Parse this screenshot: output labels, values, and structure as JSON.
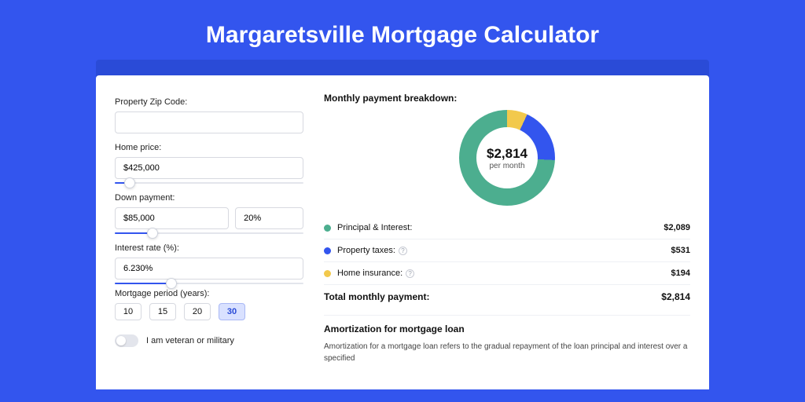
{
  "title": "Margaretsville Mortgage Calculator",
  "form": {
    "zip": {
      "label": "Property Zip Code:",
      "value": ""
    },
    "homePrice": {
      "label": "Home price:",
      "value": "$425,000",
      "sliderPct": 8
    },
    "downPayment": {
      "label": "Down payment:",
      "amount": "$85,000",
      "pct": "20%",
      "sliderPct": 20
    },
    "interest": {
      "label": "Interest rate (%):",
      "value": "6.230%",
      "sliderPct": 30
    },
    "period": {
      "label": "Mortgage period (years):",
      "options": [
        "10",
        "15",
        "20",
        "30"
      ],
      "selected": "30"
    },
    "veteran": {
      "label": "I am veteran or military",
      "on": false
    }
  },
  "breakdown": {
    "title": "Monthly payment breakdown:",
    "centerValue": "$2,814",
    "centerSub": "per month",
    "items": [
      {
        "label": "Principal & Interest:",
        "value": "$2,089",
        "color": "#4cae8f",
        "help": false
      },
      {
        "label": "Property taxes:",
        "value": "$531",
        "color": "#3355ee",
        "help": true
      },
      {
        "label": "Home insurance:",
        "value": "$194",
        "color": "#f2c94c",
        "help": true
      }
    ],
    "totalLabel": "Total monthly payment:",
    "totalValue": "$2,814"
  },
  "chart_data": {
    "type": "pie",
    "title": "Monthly payment breakdown",
    "series": [
      {
        "name": "Principal & Interest",
        "value": 2089,
        "color": "#4cae8f"
      },
      {
        "name": "Property taxes",
        "value": 531,
        "color": "#3355ee"
      },
      {
        "name": "Home insurance",
        "value": 194,
        "color": "#f2c94c"
      }
    ],
    "total": 2814
  },
  "amortization": {
    "title": "Amortization for mortgage loan",
    "text": "Amortization for a mortgage loan refers to the gradual repayment of the loan principal and interest over a specified"
  }
}
